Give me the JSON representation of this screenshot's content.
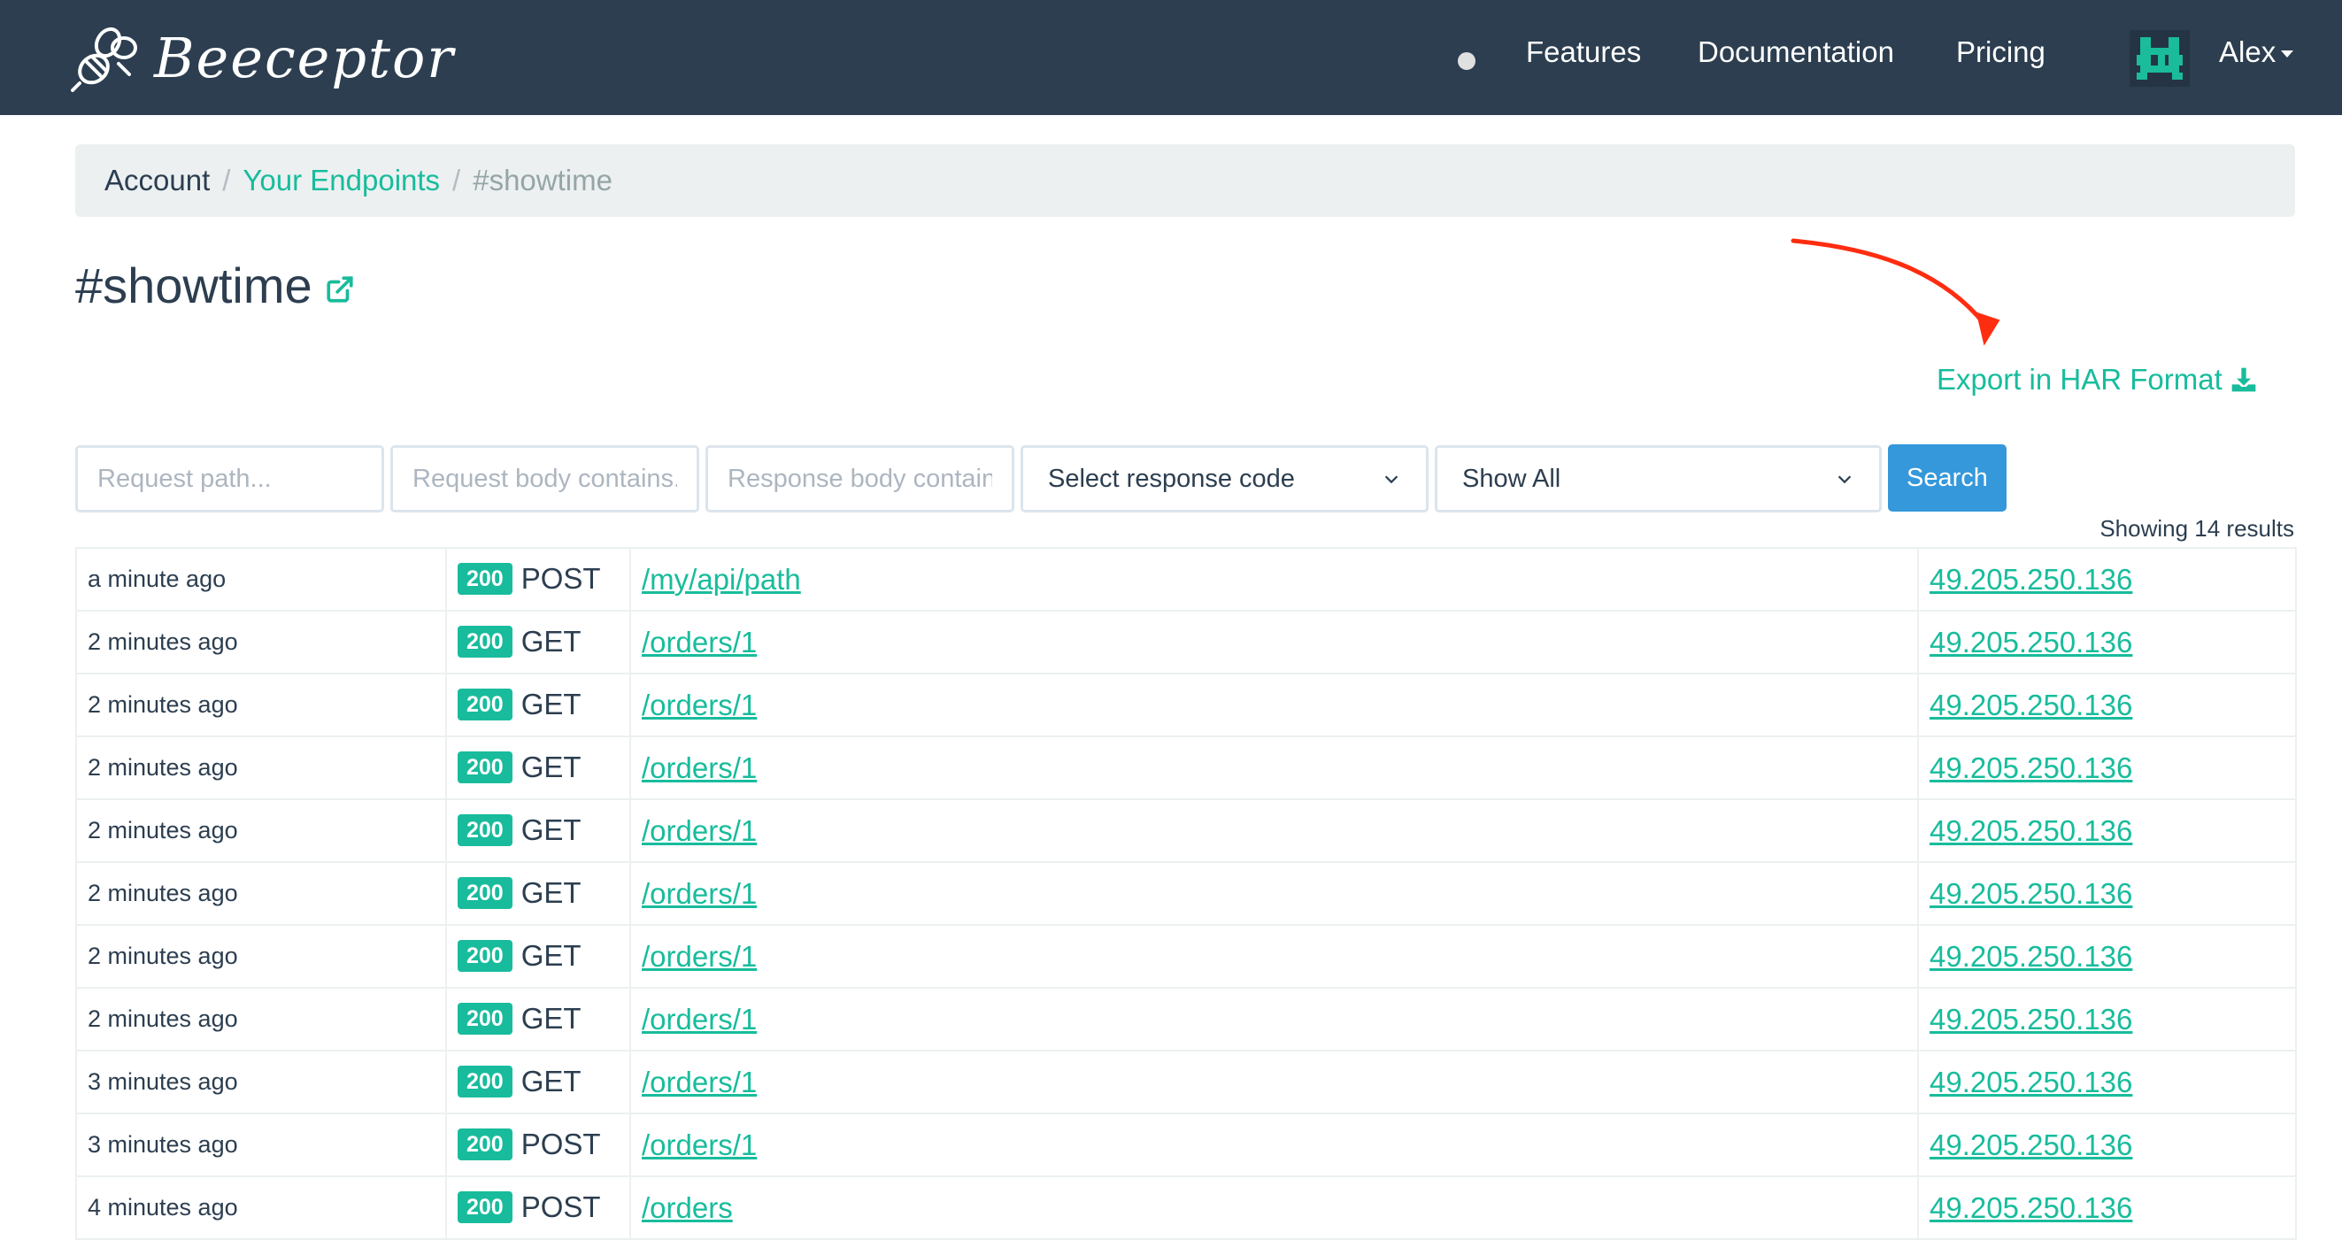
{
  "brand": {
    "name": "Beeceptor",
    "logo_icon": "bee-icon"
  },
  "nav": {
    "links": [
      "Features",
      "Documentation",
      "Pricing"
    ],
    "user": "Alex"
  },
  "breadcrumb": {
    "account": "Account",
    "separator": "/",
    "endpoints": "Your Endpoints",
    "current": "#showtime"
  },
  "page": {
    "title": "#showtime",
    "export_label": "Export in HAR Format"
  },
  "filters": {
    "path_placeholder": "Request path...",
    "req_body_placeholder": "Request body contains...",
    "resp_body_placeholder": "Response body contains",
    "response_code_selected": "Select response code",
    "show_selected": "Show All",
    "search_label": "Search",
    "results_text": "Showing 14 results"
  },
  "colors": {
    "accent": "#18bc9c",
    "navbar": "#2c3e50",
    "button": "#3498db"
  },
  "requests": [
    {
      "time": "a minute ago",
      "status": "200",
      "method": "POST",
      "path": "/my/api/path",
      "ip": "49.205.250.136"
    },
    {
      "time": "2 minutes ago",
      "status": "200",
      "method": "GET",
      "path": "/orders/1",
      "ip": "49.205.250.136"
    },
    {
      "time": "2 minutes ago",
      "status": "200",
      "method": "GET",
      "path": "/orders/1",
      "ip": "49.205.250.136"
    },
    {
      "time": "2 minutes ago",
      "status": "200",
      "method": "GET",
      "path": "/orders/1",
      "ip": "49.205.250.136"
    },
    {
      "time": "2 minutes ago",
      "status": "200",
      "method": "GET",
      "path": "/orders/1",
      "ip": "49.205.250.136"
    },
    {
      "time": "2 minutes ago",
      "status": "200",
      "method": "GET",
      "path": "/orders/1",
      "ip": "49.205.250.136"
    },
    {
      "time": "2 minutes ago",
      "status": "200",
      "method": "GET",
      "path": "/orders/1",
      "ip": "49.205.250.136"
    },
    {
      "time": "2 minutes ago",
      "status": "200",
      "method": "GET",
      "path": "/orders/1",
      "ip": "49.205.250.136"
    },
    {
      "time": "3 minutes ago",
      "status": "200",
      "method": "GET",
      "path": "/orders/1",
      "ip": "49.205.250.136"
    },
    {
      "time": "3 minutes ago",
      "status": "200",
      "method": "POST",
      "path": "/orders/1",
      "ip": "49.205.250.136"
    },
    {
      "time": "4 minutes ago",
      "status": "200",
      "method": "POST",
      "path": "/orders",
      "ip": "49.205.250.136"
    }
  ]
}
